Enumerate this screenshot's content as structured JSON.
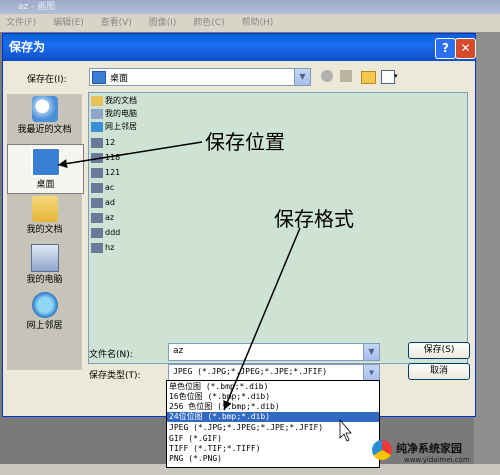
{
  "background": {
    "title": "az - 画图",
    "menu": [
      "文件(F)",
      "编辑(E)",
      "查看(V)",
      "图像(I)",
      "颜色(C)",
      "帮助(H)"
    ]
  },
  "dialog": {
    "title": "保存为",
    "help": "?",
    "close": "✕",
    "save_in_label": "保存在(I):",
    "save_in_value": "桌面",
    "places": [
      {
        "label": "我最近的文档",
        "icon": "recent-docs-icon"
      },
      {
        "label": "桌面",
        "icon": "desktop-icon"
      },
      {
        "label": "我的文档",
        "icon": "my-documents-icon"
      },
      {
        "label": "我的电脑",
        "icon": "my-computer-icon"
      },
      {
        "label": "网上邻居",
        "icon": "network-places-icon"
      }
    ],
    "files": [
      "我的文档",
      "我的电脑",
      "网上邻居",
      "12",
      "118",
      "121",
      "ac",
      "ad",
      "az",
      "ddd",
      "hz"
    ],
    "filename_label": "文件名(N):",
    "filename_value": "az",
    "filetype_label": "保存类型(T):",
    "filetype_value": "JPEG (*.JPG;*.JPEG;*.JPE;*.JFIF)",
    "save_button": "保存(S)",
    "cancel_button": "取消",
    "type_options": [
      "单色位图 (*.bmp;*.dib)",
      "16色位图 (*.bmp;*.dib)",
      "256 色位图 (*.bmp;*.dib)",
      "24位位图 (*.bmp;*.dib)",
      "JPEG (*.JPG;*.JPEG;*.JPE;*.JFIF)",
      "GIF (*.GIF)",
      "TIFF (*.TIF;*.TIFF)",
      "PNG (*.PNG)"
    ],
    "highlighted_option": 3
  },
  "annotations": {
    "location": "保存位置",
    "format": "保存格式"
  },
  "watermark": {
    "title": "纯净系统家园",
    "url": "www.yidaimei.com"
  }
}
